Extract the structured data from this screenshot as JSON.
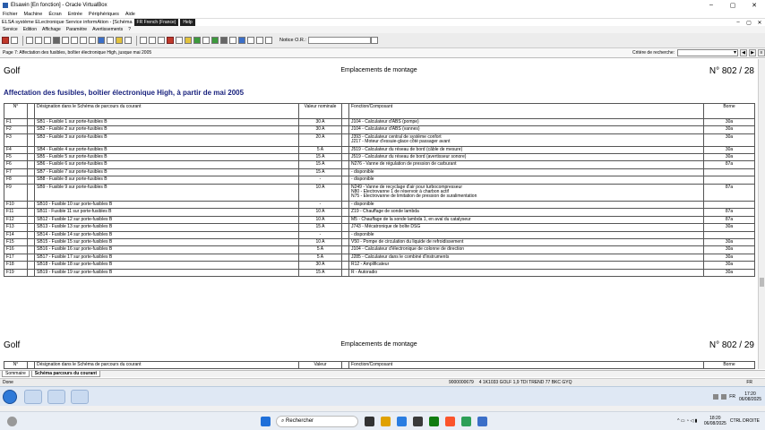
{
  "vbox": {
    "title": "Elsawin [En fonction] - Oracle VirtualBox",
    "menu": [
      "Fichier",
      "Machine",
      "Écran",
      "Entrée",
      "Périphériques",
      "Aide"
    ]
  },
  "elsa": {
    "title": "ELSA système ELectronique Service informAtion - [Schéma",
    "lang": "FR French (France)",
    "help": "Help",
    "menu": [
      "Service",
      "Edition",
      "Affichage",
      "Paramètre",
      "Avertissements",
      "?"
    ],
    "ordre_label": "Notice O.R.:"
  },
  "info": {
    "page": "Page 7: Affectation des fusibles, boîtier électronique High, jusque mai 2005",
    "critere_label": "Critère de recherche:"
  },
  "doc": {
    "header1": {
      "left": "Golf",
      "center": "Emplacements de montage",
      "right": "N° 802 / 28"
    },
    "section_title": "Affectation des fusibles, boîtier électronique High, à partir de mai 2005",
    "columns": [
      "N°",
      "Désignation dans le Schéma de parcours du courant",
      "Valeur nominale",
      "Fonction/Composant",
      "Borne"
    ],
    "rows": [
      {
        "n": "F1",
        "desig": "SB1 - Fusible 1 sur porte-fusibles B",
        "val": "30 A",
        "fn": "J104 - Calculateur d'ABS (pompe)",
        "borne": "30a"
      },
      {
        "n": "F2",
        "desig": "SB2 - Fusible 2 sur porte-fusibles B",
        "val": "30 A",
        "fn": "J104 - Calculateur d'ABS (vannes)",
        "borne": "30a"
      },
      {
        "n": "F3",
        "desig": "SB3 - Fusible 3 sur porte-fusibles B",
        "val": "20 A",
        "fn": "J393 - Calculateur central de système confort\nJ217 - Moteur d'essuie-glace côté passager avant",
        "borne": "30a"
      },
      {
        "n": "F4",
        "desig": "SB4 - Fusible 4 sur porte-fusibles B",
        "val": "5 A",
        "fn": "J519 - Calculateur du réseau de bord (câble de mesure)",
        "borne": "30a"
      },
      {
        "n": "F5",
        "desig": "SB5 - Fusible 5 sur porte-fusibles B",
        "val": "15 A",
        "fn": "J519 - Calculateur du réseau de bord (avertisseur sonore)",
        "borne": "30a"
      },
      {
        "n": "F6",
        "desig": "SB6 - Fusible 6 sur porte-fusibles B",
        "val": "15 A",
        "fn": "N276 - Vanne de régulation de pression de carburant",
        "borne": "87a"
      },
      {
        "n": "F7",
        "desig": "SB7 - Fusible 7 sur porte-fusibles B",
        "val": "15 A",
        "fn": "- disponible",
        "borne": ""
      },
      {
        "n": "F8",
        "desig": "SB8 - Fusible 8 sur porte-fusibles B",
        "val": "-",
        "fn": "- disponible",
        "borne": ""
      },
      {
        "n": "F9",
        "desig": "SB9 - Fusible 9 sur porte-fusibles B",
        "val": "10 A",
        "fn": "N249 - Vanne de recyclage d'air pour turbocompresseur\nN80 - Electrovanne 1 de réservoir à charbon actif\nN75 - Electrovanne de limitation de pression de suralimentation",
        "borne": "87a"
      },
      {
        "n": "F10",
        "desig": "SB10 - Fusible 10 sur porte-fusibles B",
        "val": "-",
        "fn": "- disponible",
        "borne": ""
      },
      {
        "n": "F11",
        "desig": "SB11 - Fusible 11 sur porte-fusibles B",
        "val": "10 A",
        "fn": "Z19 - Chauffage de sonde lambda",
        "borne": "87a"
      },
      {
        "n": "F12",
        "desig": "SB12 - Fusible 12 sur porte-fusibles B",
        "val": "10 A",
        "fn": "M5 - Chauffage de la sonde lambda 1, en aval du catalyseur",
        "borne": "87a"
      },
      {
        "n": "F13",
        "desig": "SB13 - Fusible 13 sur porte-fusibles B",
        "val": "15 A",
        "fn": "J743 - Mécatronique de boîte DSG",
        "borne": "30a"
      },
      {
        "n": "F14",
        "desig": "SB14 - Fusible 14 sur porte-fusibles B",
        "val": "-",
        "fn": "- disponible",
        "borne": ""
      },
      {
        "n": "F15",
        "desig": "SB15 - Fusible 15 sur porte-fusibles B",
        "val": "10 A",
        "fn": "V50 - Pompe de circulation du liquide de refroidissement",
        "borne": "30a"
      },
      {
        "n": "F16",
        "desig": "SB16 - Fusible 16 sur porte-fusibles B",
        "val": "5 A",
        "fn": "J104 - Calculateur d'électronique de colonne de direction",
        "borne": "30a"
      },
      {
        "n": "F17",
        "desig": "SB17 - Fusible 17 sur porte-fusibles B",
        "val": "5 A",
        "fn": "J285 - Calculateur dans le combiné d'instruments",
        "borne": "30a"
      },
      {
        "n": "F18",
        "desig": "SB18 - Fusible 18 sur porte-fusibles B",
        "val": "30 A",
        "fn": "R12 - Amplificateur",
        "borne": "30a"
      },
      {
        "n": "F19",
        "desig": "SB19 - Fusible 19 sur porte-fusibles B",
        "val": "15 A",
        "fn": "R - Autoradio",
        "borne": "30a"
      }
    ],
    "header2": {
      "left": "Golf",
      "center": "Emplacements de montage",
      "right": "N° 802 / 29"
    },
    "columns2": [
      "N°",
      "Désignation dans le Schéma de parcours du courant",
      "Valeur",
      "Fonction/Composant",
      "Borne"
    ]
  },
  "tabs": [
    "Sommaire",
    "Schéma parcours du courant"
  ],
  "status": {
    "left": "Done",
    "num": "9000000679",
    "info": "4  1K1033  GOLF 1,9 TDI TREND 77  BKC  GYQ",
    "lang": "FR"
  },
  "vmtaskbar": {
    "time": "17:20",
    "date": "06/08/2025",
    "lang": "FR"
  },
  "wintaskbar": {
    "search": "Rechercher",
    "time": "18:20",
    "date": "06/08/2025",
    "ctrl": "CTRL DROITE"
  }
}
